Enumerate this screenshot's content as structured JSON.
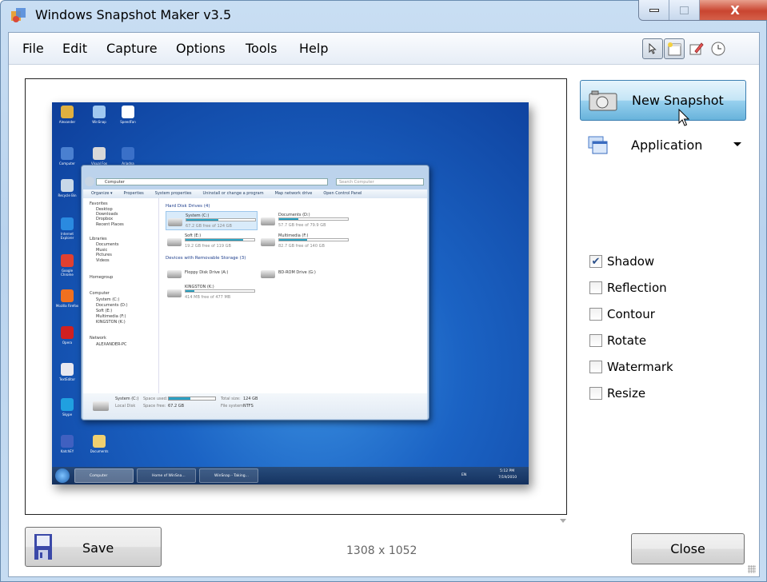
{
  "window": {
    "title": "Windows Snapshot Maker v3.5",
    "close_glyph": "X"
  },
  "menu": [
    "File",
    "Edit",
    "Capture",
    "Options",
    "Tools",
    "Help"
  ],
  "toolbar": [
    {
      "icon": "pointer-icon",
      "active": true
    },
    {
      "icon": "new-window-icon",
      "active": true
    },
    {
      "icon": "edit-icon",
      "active": false
    },
    {
      "icon": "clock-icon",
      "active": false
    }
  ],
  "preview": {
    "desktop_icons": [
      "Alexander",
      "WinSnap",
      "SpeedFan",
      "Computer",
      "Visual Fox",
      "Ariadna",
      "Recycle Bin",
      "Internet Explorer",
      "Google Chrome",
      "Mozilla Firefox",
      "Opera",
      "TextEditor",
      "Skype",
      "KatchEY",
      "Documents"
    ],
    "explorer": {
      "address": "Computer",
      "search_placeholder": "Search Computer",
      "commands": [
        "Organize ▾",
        "Properties",
        "System properties",
        "Uninstall or change a program",
        "Map network drive",
        "Open Control Panel"
      ],
      "nav": [
        "Favorites",
        "Desktop",
        "Downloads",
        "Dropbox",
        "Recent Places",
        "Libraries",
        "Documents",
        "Music",
        "Pictures",
        "Videos",
        "Homegroup",
        "Computer",
        "System (C:)",
        "Documents (D:)",
        "Soft (E:)",
        "Multimedia (F:)",
        "KINGSTON (K:)",
        "Network",
        "ALEXANDER-PC"
      ],
      "group_hdd": "Hard Disk Drives (4)",
      "group_removable": "Devices with Removable Storage (3)",
      "drives": [
        {
          "name": "System (C:)",
          "free": "67.2 GB free of 124 GB",
          "used": 0.46
        },
        {
          "name": "Documents (D:)",
          "free": "57.7 GB free of 79.9 GB",
          "used": 0.28
        },
        {
          "name": "Soft (E:)",
          "free": "19.2 GB free of 119 GB",
          "used": 0.84
        },
        {
          "name": "Multimedia (F:)",
          "free": "82.7 GB free of 140 GB",
          "used": 0.41
        },
        {
          "name": "Floppy Disk Drive (A:)"
        },
        {
          "name": "BD-ROM Drive (G:)"
        },
        {
          "name": "KINGSTON (K:)",
          "free": "414 MB free of 477 MB",
          "used": 0.13
        }
      ],
      "details": {
        "name": "System (C:)",
        "type": "Local Disk",
        "used_label": "Space used:",
        "free_label": "Space free:",
        "free": "67.2 GB",
        "total_label": "Total size:",
        "total": "124 GB",
        "fs_label": "File system:",
        "fs": "NTFS"
      }
    },
    "taskbar": {
      "tasks": [
        "Computer",
        "Home of WinSna...",
        "WinSnap - Taking..."
      ],
      "lang": "EN",
      "time": "5:12 PM",
      "date": "7/19/2010"
    }
  },
  "new_snapshot_label": "New Snapshot",
  "capture_mode": "Application",
  "options": [
    {
      "label": "Shadow",
      "checked": true
    },
    {
      "label": "Reflection",
      "checked": false
    },
    {
      "label": "Contour",
      "checked": false
    },
    {
      "label": "Rotate",
      "checked": false
    },
    {
      "label": "Watermark",
      "checked": false
    },
    {
      "label": "Resize",
      "checked": false
    }
  ],
  "save_label": "Save",
  "dimensions": "1308 x 1052",
  "close_label": "Close"
}
